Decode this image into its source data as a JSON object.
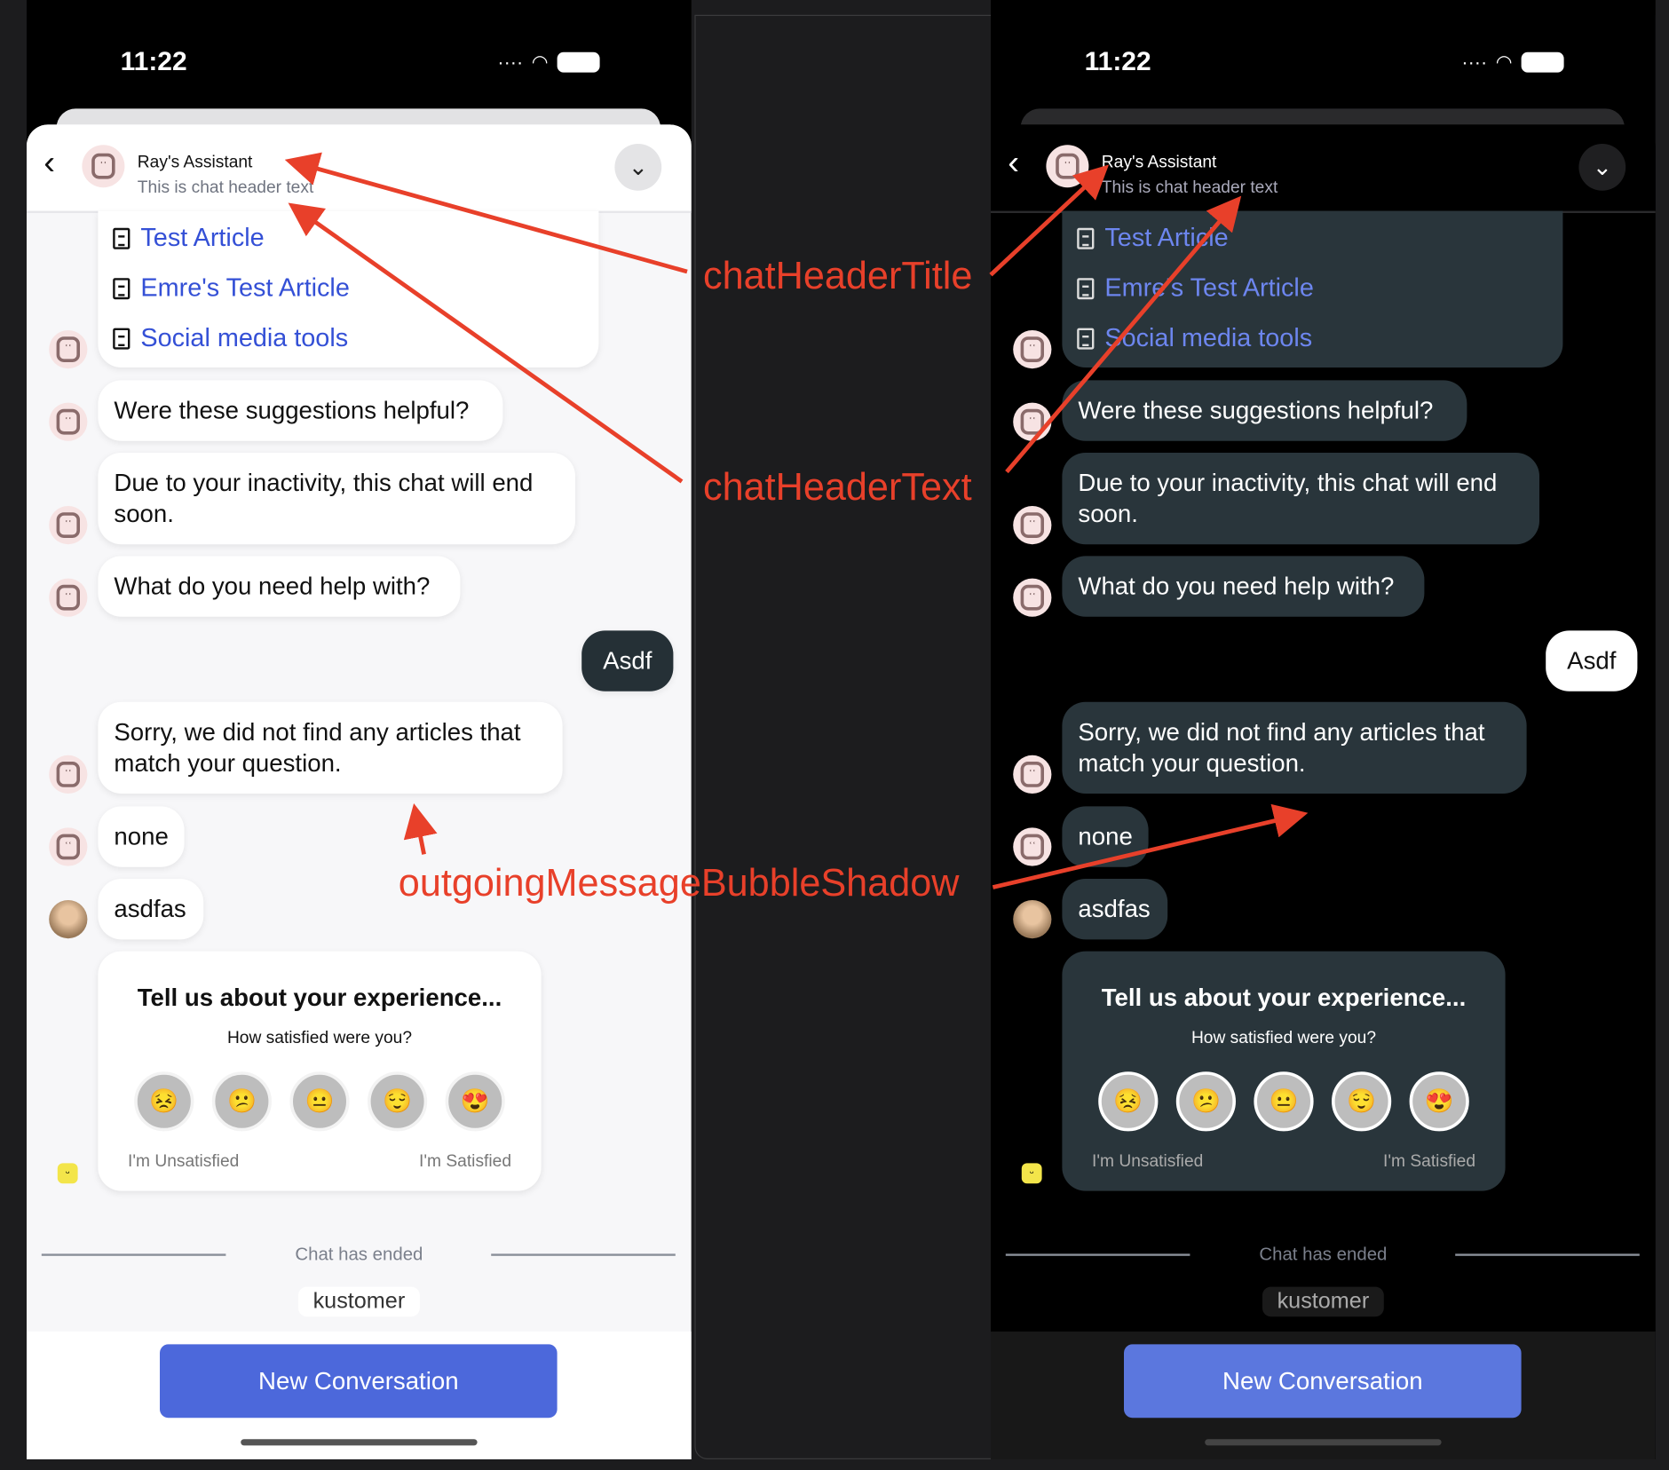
{
  "status_bar": {
    "time": "11:22"
  },
  "header": {
    "title": "Ray's Assistant",
    "subtitle": "This is chat header text"
  },
  "messages": {
    "articles": [
      "Test Article",
      "Emre's Test Article",
      "Social media tools"
    ],
    "helpful": "Were these suggestions helpful?",
    "inactivity": "Due to your inactivity, this chat will end soon.",
    "help": "What do you need help with?",
    "outgoing": "Asdf",
    "sorry": "Sorry, we did not find any articles that match your question.",
    "none": "none",
    "user_reply": "asdfas"
  },
  "survey": {
    "title": "Tell us about your experience...",
    "question": "How satisfied were you?",
    "ratings": [
      "very-unsatisfied",
      "unsatisfied",
      "neutral",
      "satisfied",
      "very-satisfied"
    ],
    "low_label": "I'm Unsatisfied",
    "high_label": "I'm Satisfied"
  },
  "footer": {
    "ended": "Chat has ended",
    "logo": "kustomer",
    "new_conversation": "New Conversation"
  },
  "annotations": {
    "title_label": "chatHeaderTitle",
    "text_label": "chatHeaderText",
    "shadow_label": "outgoingMessageBubbleShadow",
    "color": "#e8402a"
  },
  "themes": [
    "light",
    "dark"
  ]
}
